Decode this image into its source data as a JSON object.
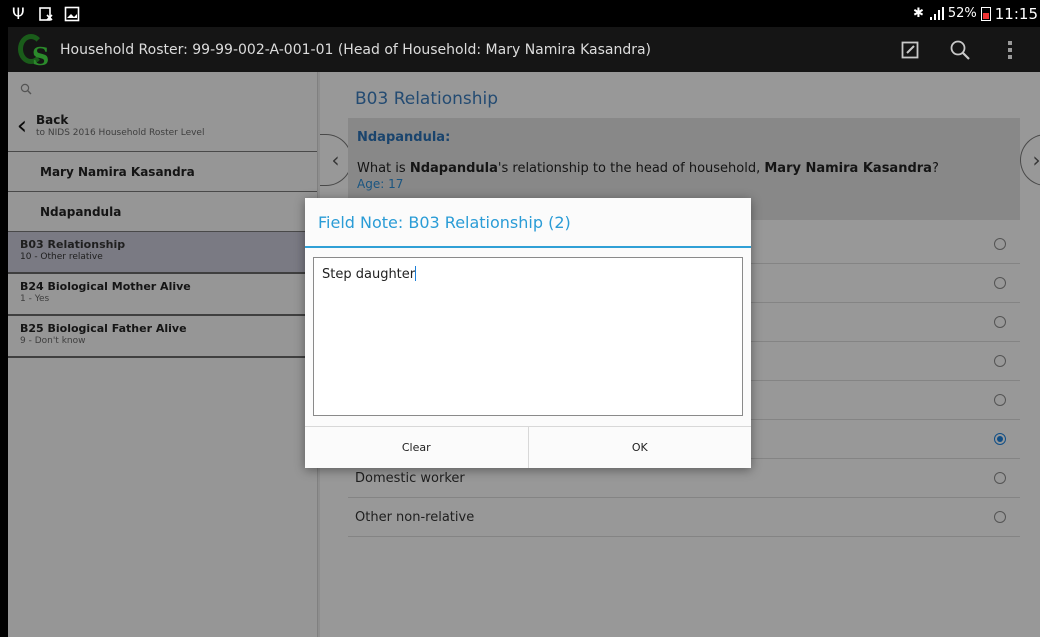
{
  "status": {
    "icons": [
      "usb-icon",
      "sim-icon",
      "image-icon"
    ],
    "battery": "52%",
    "time": "11:15"
  },
  "actionbar": {
    "title": "Household Roster: 99-99-002-A-001-01 (Head of Household: Mary Namira Kasandra)",
    "actions": [
      "edit-note-icon",
      "search-icon",
      "overflow-icon"
    ]
  },
  "sidebar": {
    "back": {
      "label": "Back",
      "sublabel": "to NIDS 2016 Household Roster Level"
    },
    "persons": [
      "Mary Namira Kasandra",
      "Ndapandula"
    ],
    "questions": [
      {
        "title": "B03 Relationship",
        "value": "10 - Other relative",
        "active": true
      },
      {
        "title": "B24 Biological Mother Alive",
        "value": "1 - Yes",
        "active": false
      },
      {
        "title": "B25 Biological Father Alive",
        "value": "9 - Don't know",
        "active": false
      }
    ]
  },
  "question": {
    "heading": "B03 Relationship",
    "person": "Ndapandula:",
    "text_pre": "What is ",
    "text_name": "Ndapandula",
    "text_mid": "'s relationship to the head  of household, ",
    "text_head": "Mary Namira Kasandra",
    "text_post": "?",
    "age": "Age: 17"
  },
  "options": [
    {
      "label": "",
      "selected": false
    },
    {
      "label": "",
      "selected": false
    },
    {
      "label": "",
      "selected": false
    },
    {
      "label": "",
      "selected": false
    },
    {
      "label": "",
      "selected": false
    },
    {
      "label": "",
      "selected": true
    },
    {
      "label": "Domestic worker",
      "selected": false
    },
    {
      "label": "Other non-relative",
      "selected": false
    }
  ],
  "dialog": {
    "title": "Field Note: B03 Relationship (2)",
    "note_value": "Step daughter",
    "clear_label": "Clear",
    "ok_label": "OK"
  },
  "colors": {
    "accent": "#2a9cd6",
    "question_title": "#3b7ab8",
    "selected_radio": "#1b7fd8",
    "active_sidebar": "#c6c6d4"
  }
}
